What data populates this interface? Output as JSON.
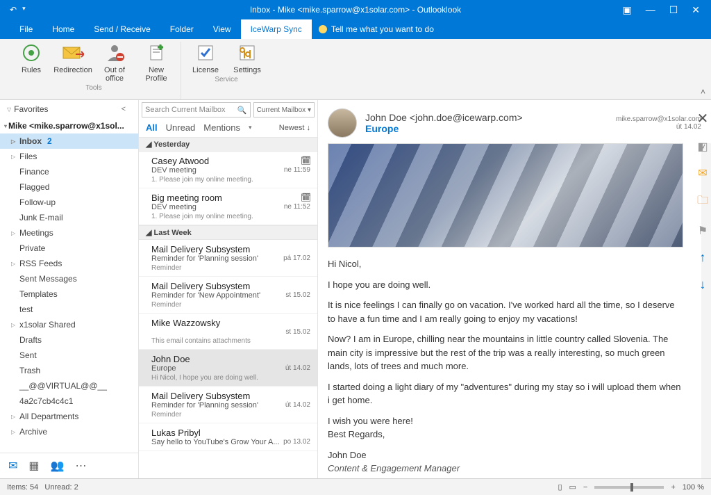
{
  "window": {
    "title": "Inbox - Mike <mike.sparrow@x1solar.com>  -  Outlooklook"
  },
  "tabs": {
    "file": "File",
    "home": "Home",
    "sendreceive": "Send / Receive",
    "folder": "Folder",
    "view": "View",
    "icewarp": "IceWarp Sync",
    "tellme": "Tell me what you want to do"
  },
  "ribbon": {
    "rules": "Rules",
    "redirection": "Redirection",
    "outofoffice": "Out of office",
    "newprofile": "New Profile",
    "license": "License",
    "settings": "Settings",
    "group_tools": "Tools",
    "group_service": "Service"
  },
  "nav": {
    "favorites": "Favorites",
    "account": "Mike <mike.sparrow@x1sol...",
    "items": [
      {
        "label": "Inbox",
        "count": "2",
        "active": true,
        "expandable": true
      },
      {
        "label": "Files",
        "expandable": true
      },
      {
        "label": "Finance"
      },
      {
        "label": "Flagged"
      },
      {
        "label": "Follow-up"
      },
      {
        "label": "Junk E-mail"
      },
      {
        "label": "Meetings",
        "expandable": true
      },
      {
        "label": "Private"
      },
      {
        "label": "RSS Feeds",
        "expandable": true
      },
      {
        "label": "Sent Messages"
      },
      {
        "label": "Templates"
      },
      {
        "label": "test"
      },
      {
        "label": "x1solar Shared",
        "expandable": true
      },
      {
        "label": "Drafts"
      },
      {
        "label": "Sent"
      },
      {
        "label": "Trash"
      },
      {
        "label": "__@@VIRTUAL@@__"
      },
      {
        "label": "4a2c7cb4c4c1"
      },
      {
        "label": "All Departments",
        "expandable": true
      },
      {
        "label": "Archive",
        "expandable": true
      }
    ]
  },
  "search": {
    "placeholder": "Search Current Mailbox",
    "scope": "Current Mailbox"
  },
  "filters": {
    "all": "All",
    "unread": "Unread",
    "mentions": "Mentions",
    "sort": "Newest ↓"
  },
  "groups": [
    {
      "label": "Yesterday",
      "msgs": [
        {
          "from": "Casey Atwood",
          "subject": "DEV meeting",
          "date": "ne 11:59",
          "preview": "1. Please join my online meeting.",
          "recur": true
        },
        {
          "from": "Big meeting room",
          "subject": "DEV meeting",
          "date": "ne 11:52",
          "preview": "1. Please join my online meeting.",
          "recur": true
        }
      ]
    },
    {
      "label": "Last Week",
      "msgs": [
        {
          "from": "Mail Delivery Subsystem",
          "subject": "Reminder for 'Planning session'",
          "date": "pá 17.02",
          "preview": "Reminder"
        },
        {
          "from": "Mail Delivery Subsystem",
          "subject": "Reminder for 'New Appointment'",
          "date": "st 15.02",
          "preview": "Reminder"
        },
        {
          "from": "Mike Wazzowsky",
          "subject": "",
          "date": "st 15.02",
          "preview": "This email contains attachments"
        },
        {
          "from": "John Doe",
          "subject": "Europe",
          "date": "út 14.02",
          "preview": "Hi Nicol,  I hope you are doing well.",
          "selected": true
        },
        {
          "from": "Mail Delivery Subsystem",
          "subject": "Reminder for 'Planning session'",
          "date": "út 14.02",
          "preview": "Reminder"
        },
        {
          "from": "Lukas Pribyl",
          "subject": "Say hello to YouTube's Grow Your A...",
          "date": "po 13.02",
          "preview": ""
        }
      ]
    }
  ],
  "read": {
    "from": "John Doe <john.doe@icewarp.com>",
    "to": "mike.sparrow@x1solar.com",
    "date": "út 14.02",
    "subject": "Europe",
    "body": {
      "p1": "Hi Nicol,",
      "p2": "I hope you are doing well.",
      "p3": "It is nice feelings I can finally go on vacation. I've worked hard all the time, so I deserve to have a fun time and I am really going to enjoy my vacations!",
      "p4": "Now? I am in Europe, chilling near the mountains in little country called Slovenia. The main city is impressive but the rest of the trip was a really interesting, so much green lands, lots of trees and much more.",
      "p5": "I started doing a light diary of my \"adventures\" during my stay so i will upload them when i get home.",
      "p6": "I wish you were here!",
      "p7": "Best Regards,",
      "sig1": "John Doe",
      "sig2": "Content & Engagement Manager"
    }
  },
  "status": {
    "items": "Items: 54",
    "unread": "Unread: 2",
    "zoom": "100 %"
  }
}
